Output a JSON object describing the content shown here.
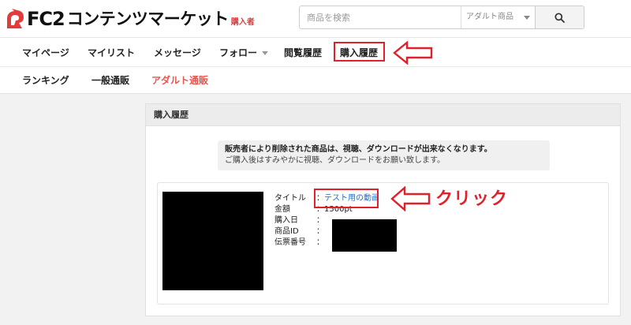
{
  "header": {
    "logo_fc2": "FC2",
    "logo_title": "コンテンツマーケット",
    "logo_sub": "購入者",
    "search": {
      "placeholder": "商品を検索",
      "category": "アダルト商品"
    }
  },
  "nav_main": {
    "items": [
      {
        "label": "マイページ"
      },
      {
        "label": "マイリスト"
      },
      {
        "label": "メッセージ"
      },
      {
        "label": "フォロー"
      },
      {
        "label": "閲覧履歴"
      },
      {
        "label": "購入履歴"
      }
    ]
  },
  "nav_sub": {
    "items": [
      {
        "label": "ランキング"
      },
      {
        "label": "一般通販"
      },
      {
        "label": "アダルト通販"
      }
    ]
  },
  "panel": {
    "title": "購入履歴",
    "notice_line1": "販売者により削除された商品は、視聴、ダウンロードが出来なくなります。",
    "notice_line2": "ご購入後はすみやかに視聴、ダウンロードをお願い致します。"
  },
  "purchase": {
    "rows": [
      {
        "label": "タイトル",
        "sep": "：",
        "value": "テスト用の動画"
      },
      {
        "label": "金額",
        "sep": "：",
        "value": "1500pt"
      },
      {
        "label": "購入日",
        "sep": "：",
        "value": ""
      },
      {
        "label": "商品ID",
        "sep": "：",
        "value": ""
      },
      {
        "label": "伝票番号",
        "sep": "：",
        "value": ""
      }
    ]
  },
  "annotation": {
    "click_text": "クリック",
    "color": "#e0202a"
  },
  "colors": {
    "accent": "#e8554e",
    "link": "#1f6fd0"
  }
}
